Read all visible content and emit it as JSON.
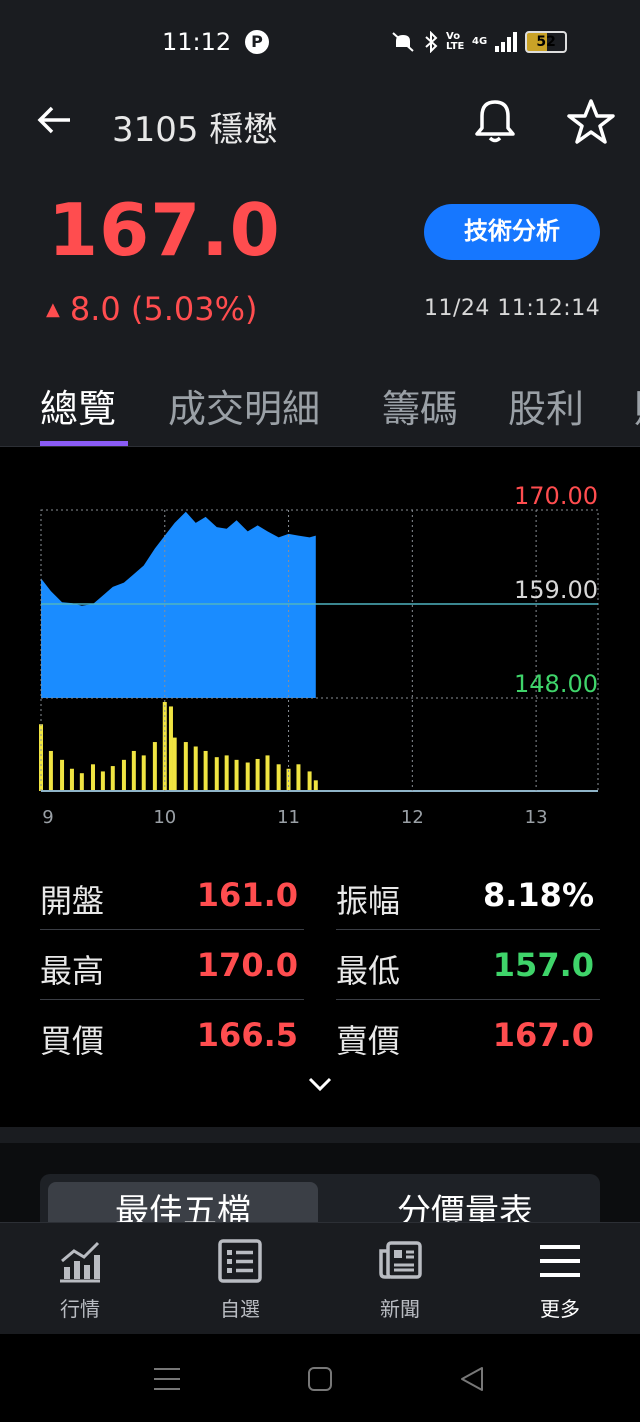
{
  "status_bar": {
    "time": "11:12",
    "p_badge": "P",
    "volte": "Vo LTE",
    "network": "4G",
    "battery": "52"
  },
  "header": {
    "title": "3105 穩懋",
    "price": "167.0",
    "change": "8.0 (5.03%)",
    "timestamp": "11/24 11:12:14",
    "tech_button": "技術分析"
  },
  "tabs": [
    {
      "label": "總覽"
    },
    {
      "label": "成交明細"
    },
    {
      "label": "籌碼"
    },
    {
      "label": "股利"
    },
    {
      "label": "財"
    }
  ],
  "colors": {
    "up": "#ff4d4f",
    "down": "#3fd46a",
    "accent": "#1677ff",
    "price_area": "#1a8cff",
    "volume": "#f0e442",
    "tab_indicator": "#8b5cf6"
  },
  "chart_data": {
    "type": "area",
    "y_labels": [
      "170.00",
      "159.00",
      "148.00"
    ],
    "ylim": [
      148,
      170
    ],
    "reference_price": 159.0,
    "x_ticks": [
      "9",
      "10",
      "11",
      "12",
      "13"
    ],
    "xlim": [
      9,
      13.5
    ],
    "price_series": {
      "x": [
        9.0,
        9.08,
        9.17,
        9.25,
        9.33,
        9.42,
        9.5,
        9.58,
        9.67,
        9.75,
        9.83,
        9.92,
        10.0,
        10.08,
        10.17,
        10.25,
        10.33,
        10.42,
        10.5,
        10.58,
        10.67,
        10.75,
        10.83,
        10.92,
        11.0,
        11.08,
        11.17,
        11.22
      ],
      "y": [
        162.0,
        160.5,
        159.2,
        159.1,
        158.8,
        159.0,
        160.0,
        161.0,
        161.5,
        162.5,
        163.5,
        165.5,
        167.0,
        168.5,
        169.8,
        168.5,
        169.2,
        168.0,
        167.8,
        168.8,
        167.5,
        168.2,
        167.5,
        166.8,
        167.2,
        167.0,
        166.8,
        167.0
      ]
    },
    "volume_series": {
      "x": [
        9.0,
        9.08,
        9.17,
        9.25,
        9.33,
        9.42,
        9.5,
        9.58,
        9.67,
        9.75,
        9.83,
        9.92,
        10.0,
        10.05,
        10.08,
        10.17,
        10.25,
        10.33,
        10.42,
        10.5,
        10.58,
        10.67,
        10.75,
        10.83,
        10.92,
        11.0,
        11.08,
        11.17,
        11.22
      ],
      "y": [
        0.75,
        0.45,
        0.35,
        0.25,
        0.2,
        0.3,
        0.22,
        0.28,
        0.35,
        0.45,
        0.4,
        0.55,
        1.0,
        0.95,
        0.6,
        0.55,
        0.5,
        0.45,
        0.38,
        0.4,
        0.35,
        0.32,
        0.36,
        0.4,
        0.3,
        0.25,
        0.3,
        0.22,
        0.12
      ]
    }
  },
  "stats": [
    {
      "label": "開盤",
      "value": "161.0",
      "color": "red"
    },
    {
      "label": "振幅",
      "value": "8.18%",
      "color": "white"
    },
    {
      "label": "最高",
      "value": "170.0",
      "color": "red"
    },
    {
      "label": "最低",
      "value": "157.0",
      "color": "green"
    },
    {
      "label": "買價",
      "value": "166.5",
      "color": "red"
    },
    {
      "label": "賣價",
      "value": "167.0",
      "color": "red"
    }
  ],
  "lower_tabs": {
    "active": "最佳五檔",
    "other": "分價量表"
  },
  "bottom_nav": [
    {
      "label": "行情",
      "icon": "market-chart-icon"
    },
    {
      "label": "自選",
      "icon": "watchlist-icon"
    },
    {
      "label": "新聞",
      "icon": "news-icon"
    },
    {
      "label": "更多",
      "icon": "menu-icon"
    }
  ]
}
